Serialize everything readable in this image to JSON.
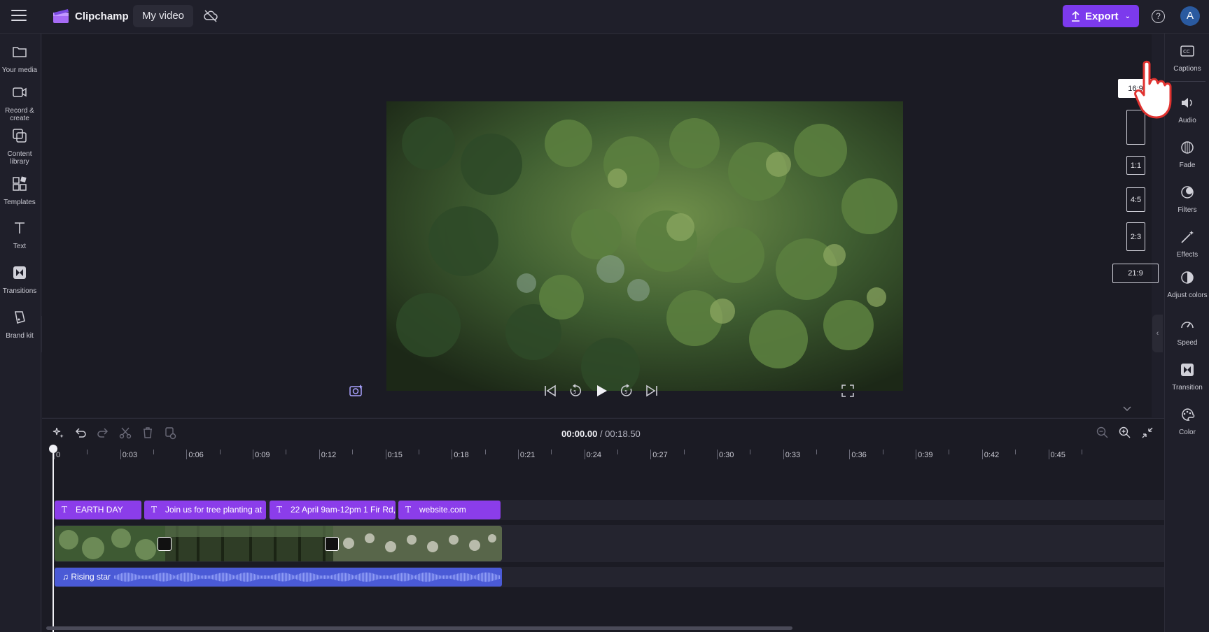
{
  "app": {
    "name": "Clipchamp",
    "project_name": "My video"
  },
  "header": {
    "export_label": "Export",
    "help_label": "?",
    "avatar_initial": "A"
  },
  "left_sidebar": [
    {
      "id": "your-media",
      "label": "Your media",
      "icon": "folder-icon"
    },
    {
      "id": "record-create",
      "label": "Record & create",
      "icon": "camera-icon"
    },
    {
      "id": "content-library",
      "label": "Content library",
      "icon": "library-icon"
    },
    {
      "id": "templates",
      "label": "Templates",
      "icon": "templates-icon"
    },
    {
      "id": "text",
      "label": "Text",
      "icon": "text-icon"
    },
    {
      "id": "transitions",
      "label": "Transitions",
      "icon": "transitions-icon"
    },
    {
      "id": "brand-kit",
      "label": "Brand kit",
      "icon": "brand-kit-icon"
    }
  ],
  "right_sidebar": [
    {
      "id": "captions",
      "label": "Captions",
      "icon": "captions-icon"
    },
    {
      "id": "audio",
      "label": "Audio",
      "icon": "audio-icon"
    },
    {
      "id": "fade",
      "label": "Fade",
      "icon": "fade-icon"
    },
    {
      "id": "filters",
      "label": "Filters",
      "icon": "filters-icon"
    },
    {
      "id": "effects",
      "label": "Effects",
      "icon": "effects-icon"
    },
    {
      "id": "adjust-colors",
      "label": "Adjust colors",
      "icon": "adjust-colors-icon"
    },
    {
      "id": "speed",
      "label": "Speed",
      "icon": "speed-icon"
    },
    {
      "id": "transition",
      "label": "Transition",
      "icon": "transition-icon"
    },
    {
      "id": "color",
      "label": "Color",
      "icon": "color-icon"
    }
  ],
  "aspect_ratios": [
    {
      "label": "16:9",
      "selected": true
    },
    {
      "label": "",
      "selected": false
    },
    {
      "label": "1:1",
      "selected": false
    },
    {
      "label": "4:5",
      "selected": false
    },
    {
      "label": "2:3",
      "selected": false
    },
    {
      "label": "21:9",
      "selected": false
    }
  ],
  "timeline": {
    "current_time": "00:00.00",
    "duration": "/ 00:18.50",
    "ruler_labels": [
      "0",
      "0:03",
      "0:06",
      "0:09",
      "0:12",
      "0:15",
      "0:18",
      "0:21",
      "0:24",
      "0:27",
      "0:30",
      "0:33",
      "0:36",
      "0:39",
      "0:42",
      "0:45"
    ],
    "text_clips": [
      "EARTH DAY",
      "Join us for tree planting at",
      "22 April 9am-12pm 1 Fir Rd,",
      "website.com"
    ],
    "audio_clip": "Rising star"
  },
  "colors": {
    "accent": "#7c3aed",
    "text_clip": "#8b3dea",
    "audio_clip": "#4a5ad6",
    "background": "#1f1f2a"
  }
}
